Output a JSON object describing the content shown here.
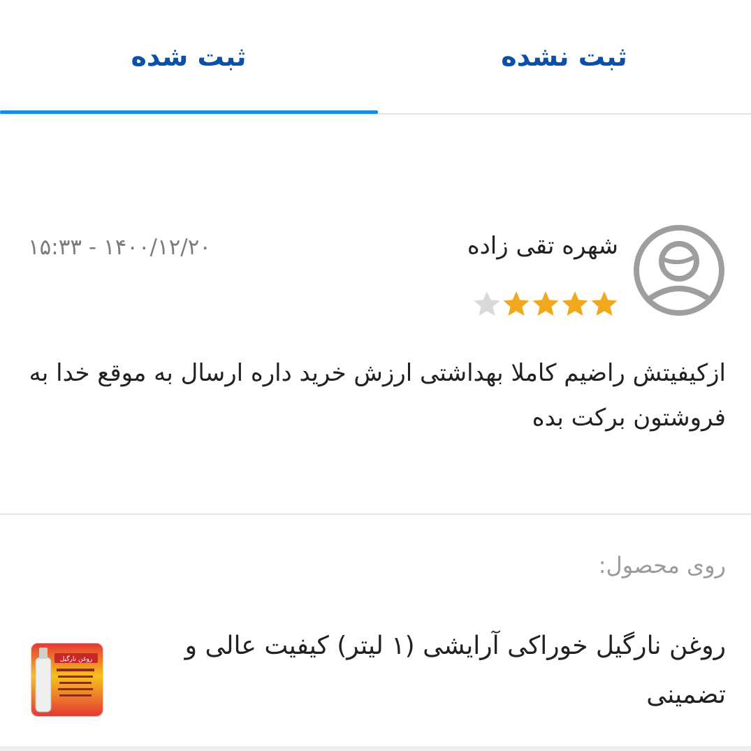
{
  "tabs": {
    "unregistered": "ثبت نشده",
    "registered": "ثبت شده",
    "active": "registered"
  },
  "review": {
    "reviewer_name": "شهره تقی زاده",
    "date": "۱۵:۳۳ - ۱۴۰۰/۱۲/۲۰",
    "rating": 4,
    "rating_max": 5,
    "text": "ازکیفیتش راضیم کاملا بهداشتی ارزش خرید داره ارسال به موقع خدا به فروشتون برکت بده"
  },
  "product": {
    "label": "روی محصول:",
    "title": "روغن نارگیل خوراکی آرایشی (۱ لیتر) کیفیت عالی و تضمینی",
    "thumb_text": "روغن نارگیل"
  },
  "colors": {
    "tab_text": "#0a4fa8",
    "tab_indicator": "#1a8be8",
    "star_filled": "#f2a81d",
    "star_empty": "#d9d9d9",
    "avatar": "#9e9e9e"
  }
}
